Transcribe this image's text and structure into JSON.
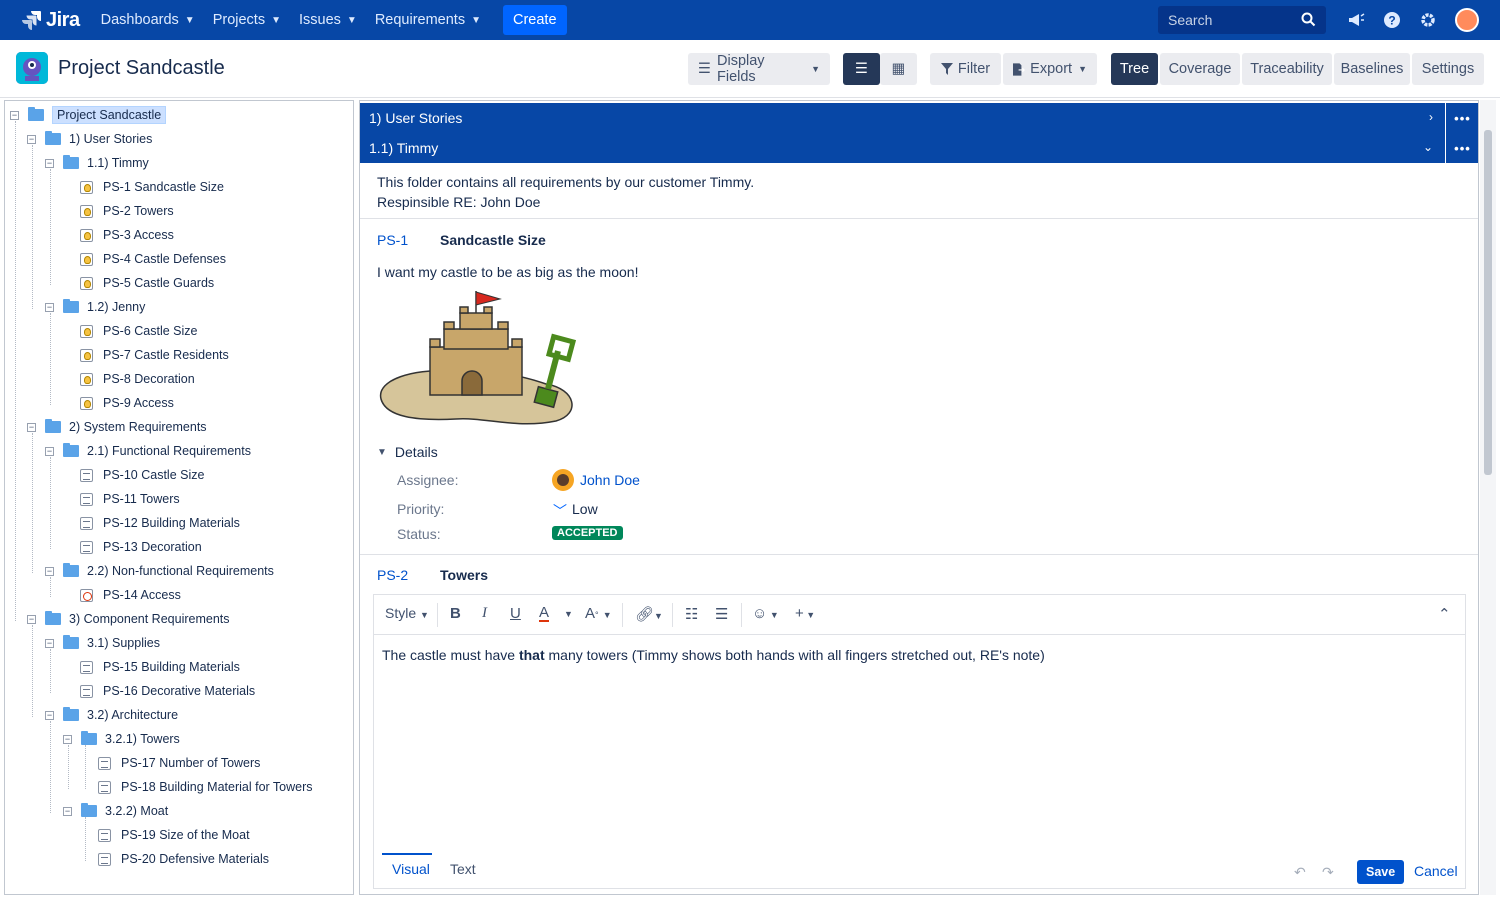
{
  "topnav": {
    "brand": "Jira",
    "items": [
      {
        "label": "Dashboards"
      },
      {
        "label": "Projects"
      },
      {
        "label": "Issues"
      },
      {
        "label": "Requirements"
      }
    ],
    "create_label": "Create",
    "search_placeholder": "Search"
  },
  "project": {
    "title": "Project Sandcastle"
  },
  "toolbar": {
    "display_fields": "Display Fields",
    "filter": "Filter",
    "export": "Export",
    "views": [
      "Tree",
      "Coverage",
      "Traceability",
      "Baselines",
      "Settings"
    ]
  },
  "tree": {
    "root": "Project Sandcastle",
    "nodes": [
      "1) User Stories",
      "1.1) Timmy",
      "PS-1 Sandcastle Size",
      "PS-2 Towers",
      "PS-3 Access",
      "PS-4 Castle Defenses",
      "PS-5 Castle Guards",
      "1.2) Jenny",
      "PS-6 Castle Size",
      "PS-7 Castle Residents",
      "PS-8 Decoration",
      "PS-9 Access",
      "2) System Requirements",
      "2.1) Functional Requirements",
      "PS-10 Castle Size",
      "PS-11 Towers",
      "PS-12 Building Materials",
      "PS-13 Decoration",
      "2.2) Non-functional Requirements",
      "PS-14 Access",
      "3) Component Requirements",
      "3.1) Supplies",
      "PS-15 Building Materials",
      "PS-16 Decorative Materials",
      "3.2) Architecture",
      "3.2.1) Towers",
      "PS-17 Number of Towers",
      "PS-18 Building Material for Towers",
      "3.2.2) Moat",
      "PS-19 Size of the Moat",
      "PS-20 Defensive Materials"
    ]
  },
  "content": {
    "bar1": "1) User Stories",
    "bar2": "1.1) Timmy",
    "folder_desc_line1": "This folder contains all requirements by our customer Timmy.",
    "folder_desc_line2": "Respinsible RE: John Doe",
    "req1": {
      "key": "PS-1",
      "title": "Sandcastle Size",
      "description": "I want my castle to be as big as the moon!",
      "details_label": "Details",
      "assignee_label": "Assignee:",
      "assignee": "John Doe",
      "priority_label": "Priority:",
      "priority": "Low",
      "status_label": "Status:",
      "status": "ACCEPTED"
    },
    "req2": {
      "key": "PS-2",
      "title": "Towers",
      "text_before": "The castle must have ",
      "text_bold": "that",
      "text_after": " many towers (Timmy shows both hands with all fingers stretched out, RE's note)"
    },
    "editor": {
      "style_label": "Style",
      "tab_visual": "Visual",
      "tab_text": "Text",
      "save": "Save",
      "cancel": "Cancel"
    }
  },
  "colors": {
    "nav_bg": "#0747a6",
    "accent": "#0052cc",
    "status_accepted": "#00875a"
  }
}
